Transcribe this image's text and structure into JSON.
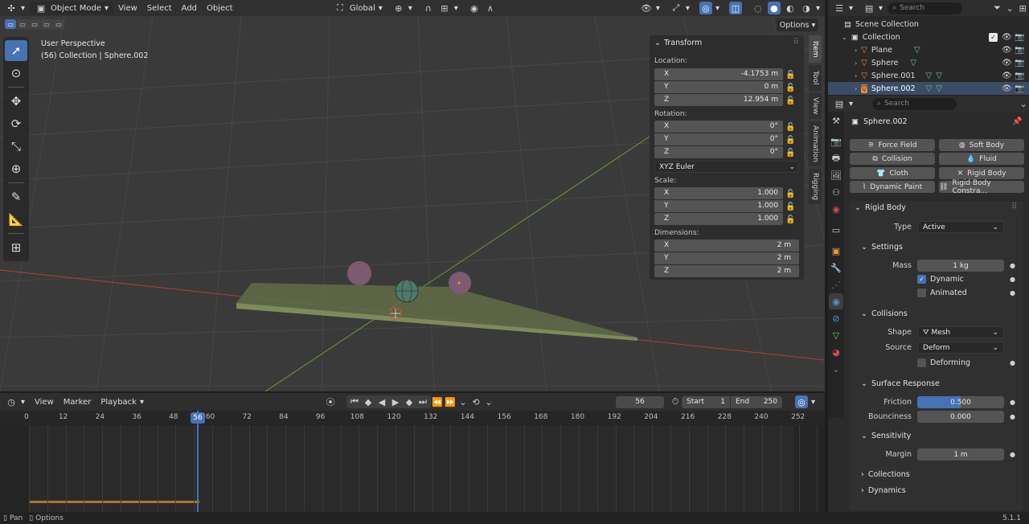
{
  "viewport": {
    "mode": "Object Mode",
    "menus": [
      "View",
      "Select",
      "Add",
      "Object"
    ],
    "orientation": "Global",
    "options": "Options",
    "info_line1": "User Perspective",
    "info_line2": "(56) Collection | Sphere.002"
  },
  "npanel": {
    "title": "Transform",
    "location_label": "Location:",
    "location": [
      {
        "axis": "X",
        "value": "-4.1753 m"
      },
      {
        "axis": "Y",
        "value": "0 m"
      },
      {
        "axis": "Z",
        "value": "12.954 m"
      }
    ],
    "rotation_label": "Rotation:",
    "rotation": [
      {
        "axis": "X",
        "value": "0°"
      },
      {
        "axis": "Y",
        "value": "0°"
      },
      {
        "axis": "Z",
        "value": "0°"
      }
    ],
    "rotation_mode": "XYZ Euler",
    "scale_label": "Scale:",
    "scale": [
      {
        "axis": "X",
        "value": "1.000"
      },
      {
        "axis": "Y",
        "value": "1.000"
      },
      {
        "axis": "Z",
        "value": "1.000"
      }
    ],
    "dimensions_label": "Dimensions:",
    "dimensions": [
      {
        "axis": "X",
        "value": "2 m"
      },
      {
        "axis": "Y",
        "value": "2 m"
      },
      {
        "axis": "Z",
        "value": "2 m"
      }
    ],
    "tabs": [
      "Item",
      "Tool",
      "View",
      "Animation",
      "Rigging"
    ]
  },
  "timeline": {
    "menus": [
      "View",
      "Marker",
      "Playback"
    ],
    "current_frame": "56",
    "start_label": "Start",
    "start": "1",
    "end_label": "End",
    "end": "250",
    "ruler": [
      "0",
      "12",
      "24",
      "36",
      "48",
      "60",
      "72",
      "84",
      "96",
      "108",
      "120",
      "132",
      "144",
      "156",
      "168",
      "180",
      "192",
      "204",
      "216",
      "228",
      "240",
      "252"
    ]
  },
  "statusbar": {
    "left1": "Pan",
    "left2": "Options",
    "version": "5.1.1"
  },
  "outliner": {
    "search_placeholder": "Search",
    "root": "Scene Collection",
    "collection": "Collection",
    "items": [
      "Plane",
      "Sphere",
      "Sphere.001",
      "Sphere.002"
    ]
  },
  "properties": {
    "search_placeholder": "Search",
    "object_name": "Sphere.002",
    "physics_buttons": [
      {
        "label": "Force Field",
        "icon": "force-field-icon"
      },
      {
        "label": "Soft Body",
        "icon": "soft-body-icon"
      },
      {
        "label": "Collision",
        "icon": "collision-icon"
      },
      {
        "label": "Fluid",
        "icon": "fluid-icon"
      },
      {
        "label": "Cloth",
        "icon": "cloth-icon"
      },
      {
        "label": "Rigid Body",
        "icon": "close-icon"
      },
      {
        "label": "Dynamic Paint",
        "icon": "dynamic-paint-icon"
      },
      {
        "label": "Rigid Body Constra...",
        "icon": "rigid-body-constraint-icon"
      }
    ],
    "rigid_body": "Rigid Body",
    "type_label": "Type",
    "type_value": "Active",
    "settings": "Settings",
    "mass_label": "Mass",
    "mass_value": "1 kg",
    "dynamic_label": "Dynamic",
    "animated_label": "Animated",
    "collisions": "Collisions",
    "shape_label": "Shape",
    "shape_value": "Mesh",
    "source_label": "Source",
    "source_value": "Deform",
    "deforming_label": "Deforming",
    "surface_response": "Surface Response",
    "friction_label": "Friction",
    "friction_value": "0.500",
    "friction_fraction": 0.5,
    "bounciness_label": "Bounciness",
    "bounciness_value": "0.000",
    "sensitivity": "Sensitivity",
    "margin_label": "Margin",
    "margin_value": "1 m",
    "sub_collections": "Collections",
    "sub_dynamics": "Dynamics"
  },
  "colors": {
    "accent": "#4772b3",
    "x_axis": "#c04040",
    "y_axis": "#6e9a3a"
  }
}
